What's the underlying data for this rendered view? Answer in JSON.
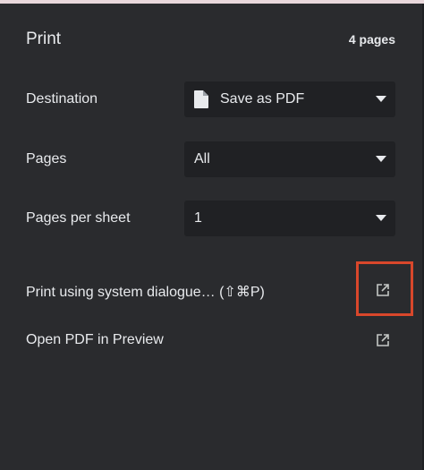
{
  "header": {
    "title": "Print",
    "page_count": "4 pages"
  },
  "destination": {
    "label": "Destination",
    "value": "Save as PDF",
    "icon": "document-icon"
  },
  "pages": {
    "label": "Pages",
    "value": "All"
  },
  "pages_per_sheet": {
    "label": "Pages per sheet",
    "value": "1"
  },
  "system_dialogue": {
    "label": "Print using system dialogue… (⇧⌘P)",
    "icon": "open-external-icon"
  },
  "open_pdf": {
    "label": "Open PDF in Preview",
    "icon": "open-external-icon"
  },
  "colors": {
    "background": "#2a2b2e",
    "select_background": "#202124",
    "text": "#e8eaed",
    "highlight": "#d9472b"
  }
}
